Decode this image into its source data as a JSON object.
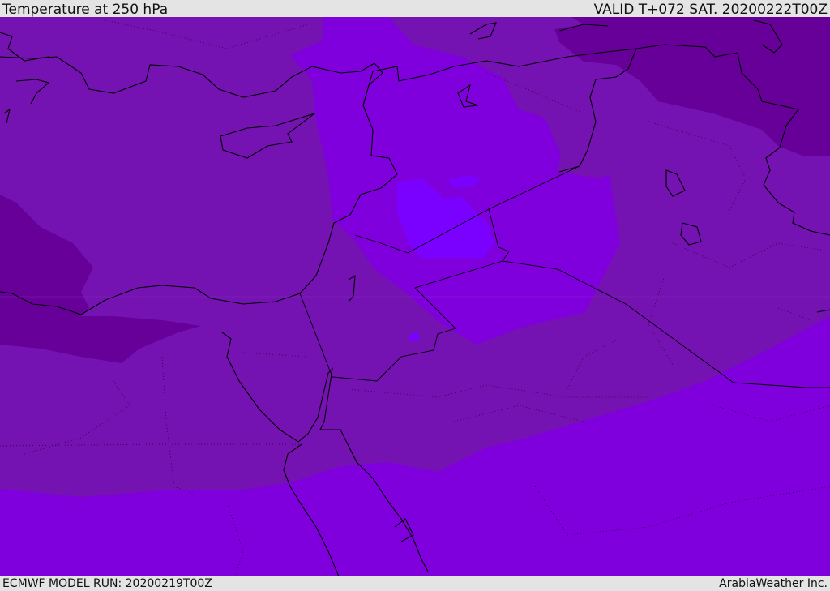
{
  "header": {
    "title": "Temperature at 250 hPa",
    "valid": "VALID T+072 SAT. 20200222T00Z"
  },
  "footer": {
    "model_run": "ECMWF MODEL RUN: 20200219T00Z",
    "credit": "ArabiaWeather Inc."
  },
  "colors": {
    "base": "#7512b2",
    "dark": "#660099",
    "violet": "#7f00dc",
    "bright": "#7a00ff",
    "background": "#e4e4e4"
  }
}
